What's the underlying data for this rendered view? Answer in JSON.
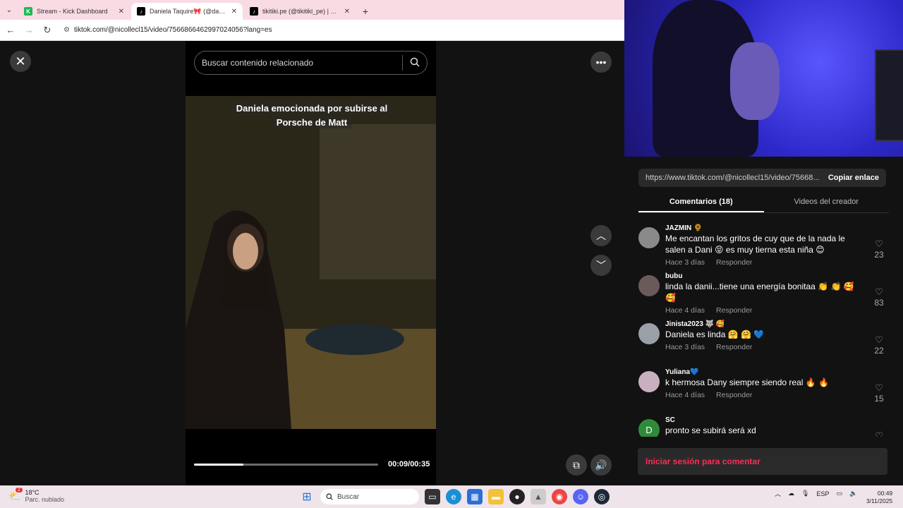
{
  "browser": {
    "tabs": [
      {
        "title": "Stream - Kick Dashboard",
        "fav_color": "#1db954",
        "fav_glyph": "K",
        "active": false
      },
      {
        "title": "Daniela Taquire🎀 (@danie",
        "fav_color": "#000000",
        "fav_glyph": "♪",
        "active": true
      },
      {
        "title": "tikitiki.pe (@tikitiki_pe) | TikTok",
        "fav_color": "#000000",
        "fav_glyph": "♪",
        "active": false
      }
    ],
    "new_tab": "+",
    "url": "tiktok.com/@nicollecl15/video/7566866462997024056?lang=es"
  },
  "video": {
    "search_placeholder": "Buscar contenido relacionado",
    "caption_line1": "Daniela emocionada por subirse al",
    "caption_line2": "Porsche de Matt",
    "time": "00:09/00:35",
    "progress_fraction": 0.27
  },
  "panel": {
    "share_url": "https://www.tiktok.com/@nicollecl15/video/75668...",
    "copy_label": "Copiar enlace",
    "tab_comments": "Comentarios (18)",
    "tab_creator": "Videos del creador",
    "reply_label": "Responder",
    "login_label": "Iniciar sesión para comentar",
    "comments": [
      {
        "user": "JAZMIN 🌻",
        "text": "Me encantan los gritos de cuy que de la nada le salen a Dani 😝 es muy tierna esta niña 😊",
        "time": "Hace 3 días",
        "likes": "23",
        "avatar": "",
        "avatar_color": "#8a8a8a"
      },
      {
        "user": "bubu",
        "text": "linda la danii...tiene una energía bonitaa 👏 👏 🥰 🥰",
        "time": "Hace 4 días",
        "likes": "83",
        "avatar": "",
        "avatar_color": "#6b5a5a"
      },
      {
        "user": "Jinista2023 🐺 🥰",
        "text": "Daniela es linda 🤗 🤗 💙",
        "time": "Hace 3 días",
        "likes": "22",
        "avatar": "",
        "avatar_color": "#9aa0a8"
      },
      {
        "user": "Yuliana💙",
        "text": "k hermosa Dany siempre siendo real 🔥 🔥",
        "time": "Hace 4 días",
        "likes": "15",
        "avatar": "",
        "avatar_color": "#c9b0c0"
      },
      {
        "user": "SC",
        "text": "pronto se subirá será xd",
        "time": "",
        "likes": "",
        "avatar": "D",
        "avatar_color": "#2e8b3a"
      }
    ]
  },
  "taskbar": {
    "weather_temp": "18°C",
    "weather_desc": "Parc. nublado",
    "weather_badge": "2",
    "search_label": "Buscar",
    "lang": "ESP",
    "time": "00:49",
    "date": "3/11/2025"
  }
}
